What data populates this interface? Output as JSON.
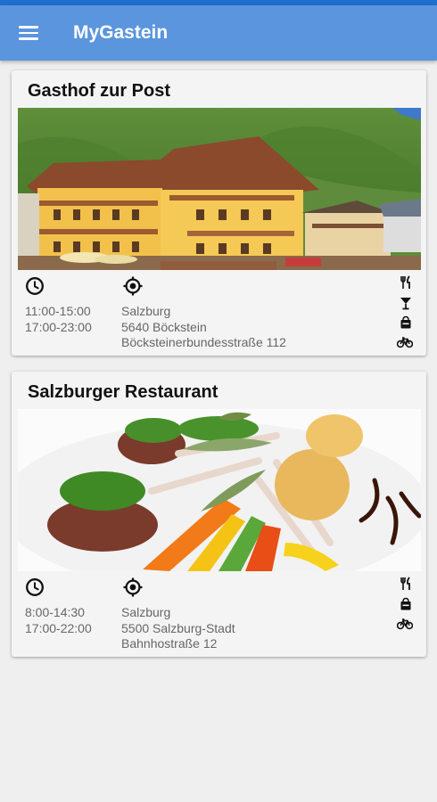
{
  "app": {
    "title": "MyGastein",
    "menu_icon": "hamburger-menu-icon"
  },
  "restaurants": [
    {
      "name": "Gasthof zur Post",
      "hours": [
        "11:00-15:00",
        "17:00-23:00"
      ],
      "address": [
        "Salzburg",
        "5640 Böckstein",
        "Böcksteinerbundesstraße 112"
      ],
      "features": [
        "cutlery-icon",
        "cocktail-glass-icon",
        "takeaway-icon",
        "bicycle-icon"
      ]
    },
    {
      "name": "Salzburger Restaurant",
      "hours": [
        "8:00-14:30",
        "17:00-22:00"
      ],
      "address": [
        "Salzburg",
        "5500 Salzburg-Stadt",
        "Bahnhostraße 12"
      ],
      "features": [
        "cutlery-icon",
        "takeaway-icon",
        "bicycle-icon"
      ]
    }
  ],
  "colors": {
    "appbar": "#5b95de",
    "statusbar": "#1e6fd0",
    "background": "#efefef",
    "card": "#f4f4f4",
    "text_secondary": "#666666"
  }
}
